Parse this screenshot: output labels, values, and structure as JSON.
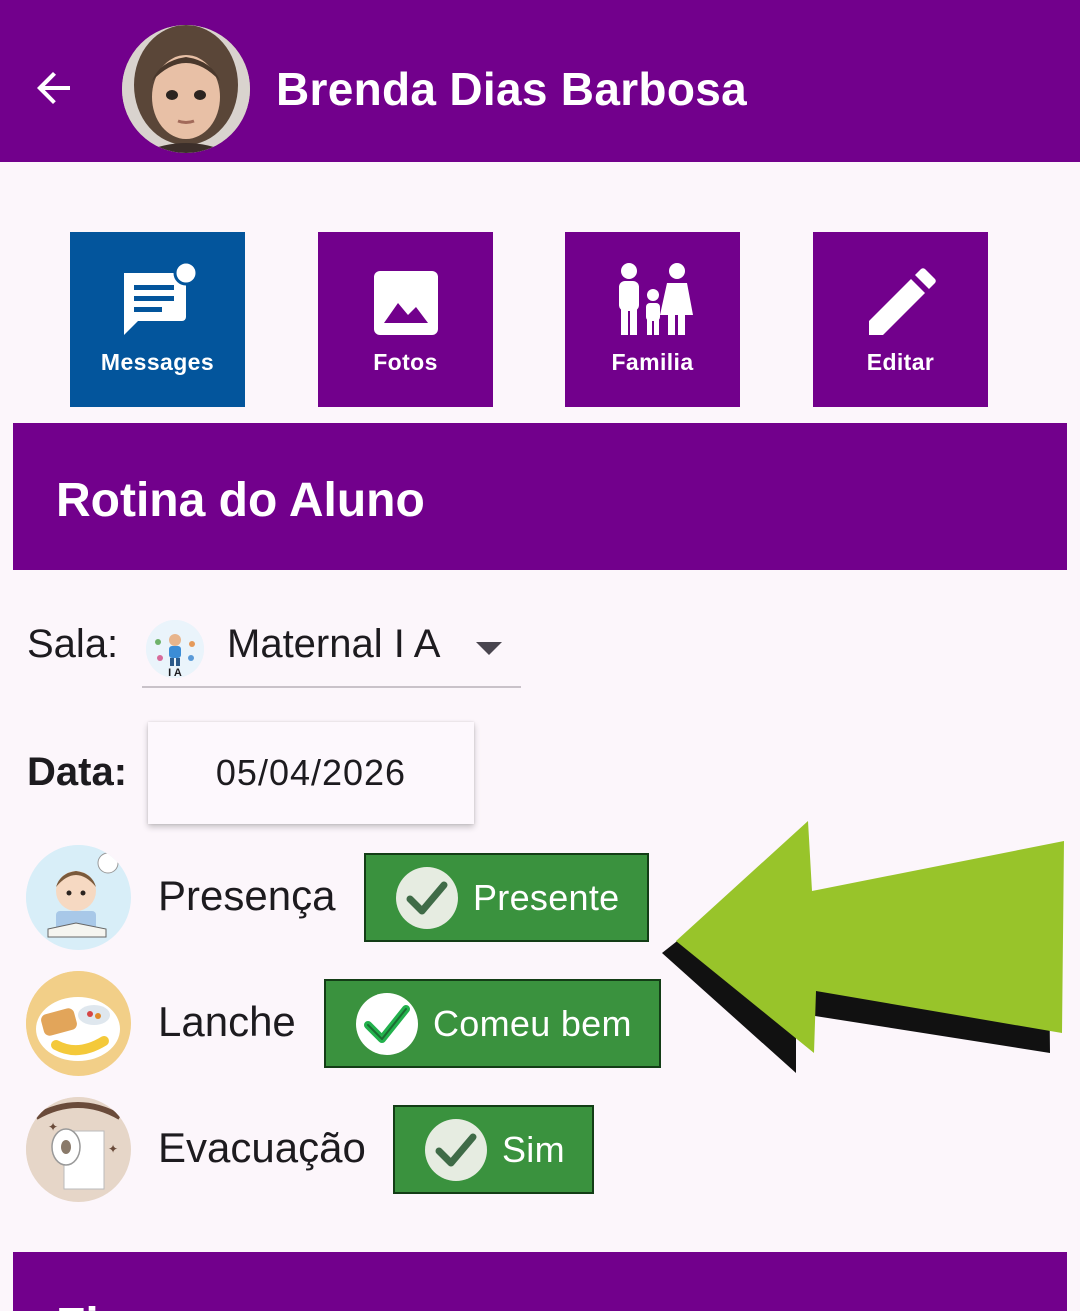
{
  "header": {
    "title": "Brenda Dias Barbosa",
    "back_icon": "arrow-back-icon",
    "color": "#72008c"
  },
  "actions": [
    {
      "label": "Messages",
      "icon": "messages-icon",
      "active": true,
      "color": "#03559c"
    },
    {
      "label": "Fotos",
      "icon": "photo-icon",
      "active": false
    },
    {
      "label": "Familia",
      "icon": "family-icon",
      "active": false
    },
    {
      "label": "Editar",
      "icon": "edit-icon",
      "active": false
    }
  ],
  "routine": {
    "title": "Rotina do Aluno",
    "sala_label": "Sala:",
    "sala_value": "Maternal I A",
    "sala_icon_text": "I A",
    "data_label": "Data:",
    "data_value": "05/04/2026",
    "items": [
      {
        "label": "Presença",
        "status": "Presente",
        "icon": "student-reading-icon"
      },
      {
        "label": "Lanche",
        "status": "Comeu bem",
        "icon": "breakfast-plate-icon"
      },
      {
        "label": "Evacuação",
        "status": "Sim",
        "icon": "toilet-paper-icon"
      }
    ],
    "status_color": "#3a923e"
  },
  "next_section": {
    "title": "Fi..."
  },
  "annotation": {
    "arrow_color": "#98c42a"
  }
}
